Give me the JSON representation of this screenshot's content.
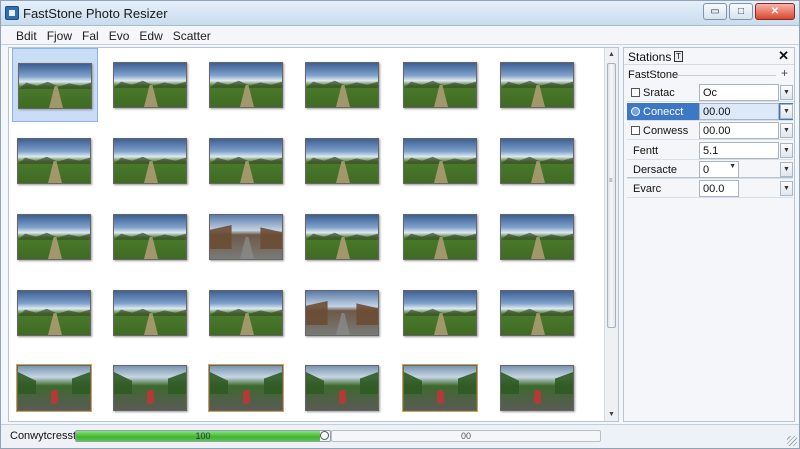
{
  "window": {
    "title": "FastStone Photo Resizer",
    "controls": [
      "▭",
      "□",
      "✕"
    ]
  },
  "menu": [
    "Bdit",
    "Fjow",
    "Fal",
    "Evo",
    "Edw",
    "Scatter"
  ],
  "thumbnails": [
    {
      "scene": "field",
      "selected": true
    },
    {
      "scene": "field"
    },
    {
      "scene": "field"
    },
    {
      "scene": "field"
    },
    {
      "scene": "field"
    },
    {
      "scene": "field"
    },
    {
      "scene": "field"
    },
    {
      "scene": "field"
    },
    {
      "scene": "field"
    },
    {
      "scene": "field"
    },
    {
      "scene": "field"
    },
    {
      "scene": "field"
    },
    {
      "scene": "field"
    },
    {
      "scene": "field"
    },
    {
      "scene": "village"
    },
    {
      "scene": "field"
    },
    {
      "scene": "field"
    },
    {
      "scene": "field"
    },
    {
      "scene": "field"
    },
    {
      "scene": "field"
    },
    {
      "scene": "field"
    },
    {
      "scene": "village"
    },
    {
      "scene": "field"
    },
    {
      "scene": "field"
    },
    {
      "scene": "rider"
    },
    {
      "scene": "rider"
    },
    {
      "scene": "rider"
    },
    {
      "scene": "rider"
    },
    {
      "scene": "rider"
    },
    {
      "scene": "rider"
    }
  ],
  "panel": {
    "title": "Stations",
    "pin_glyph": "T",
    "close_glyph": "✕",
    "subtitle": "FastStone",
    "add_glyph": "+",
    "properties": [
      {
        "name": "Sratac",
        "value": "Oc",
        "control": "checkbox",
        "selected": false
      },
      {
        "name": "Conecct",
        "value": "00.00",
        "control": "radio",
        "selected": true
      },
      {
        "name": "Conwess",
        "value": "00.00",
        "control": "checkbox",
        "selected": false
      },
      {
        "name": "Fentt",
        "value": "5.1",
        "control": "none",
        "selected": false
      },
      {
        "name": "Dersacte",
        "value": "0",
        "control": "none",
        "selected": false,
        "dropdown": true
      },
      {
        "name": "Evarc",
        "value": "00.0",
        "control": "none",
        "selected": false
      }
    ]
  },
  "status": {
    "label": "Conwytcresst",
    "progress_value": 100,
    "progress_fraction": 1.0,
    "progress_label": "100",
    "secondary_label": "00"
  },
  "colors": {
    "accent": "#3c78c6",
    "progress": "#3fb52e",
    "title_bar": "#c9dcee"
  }
}
